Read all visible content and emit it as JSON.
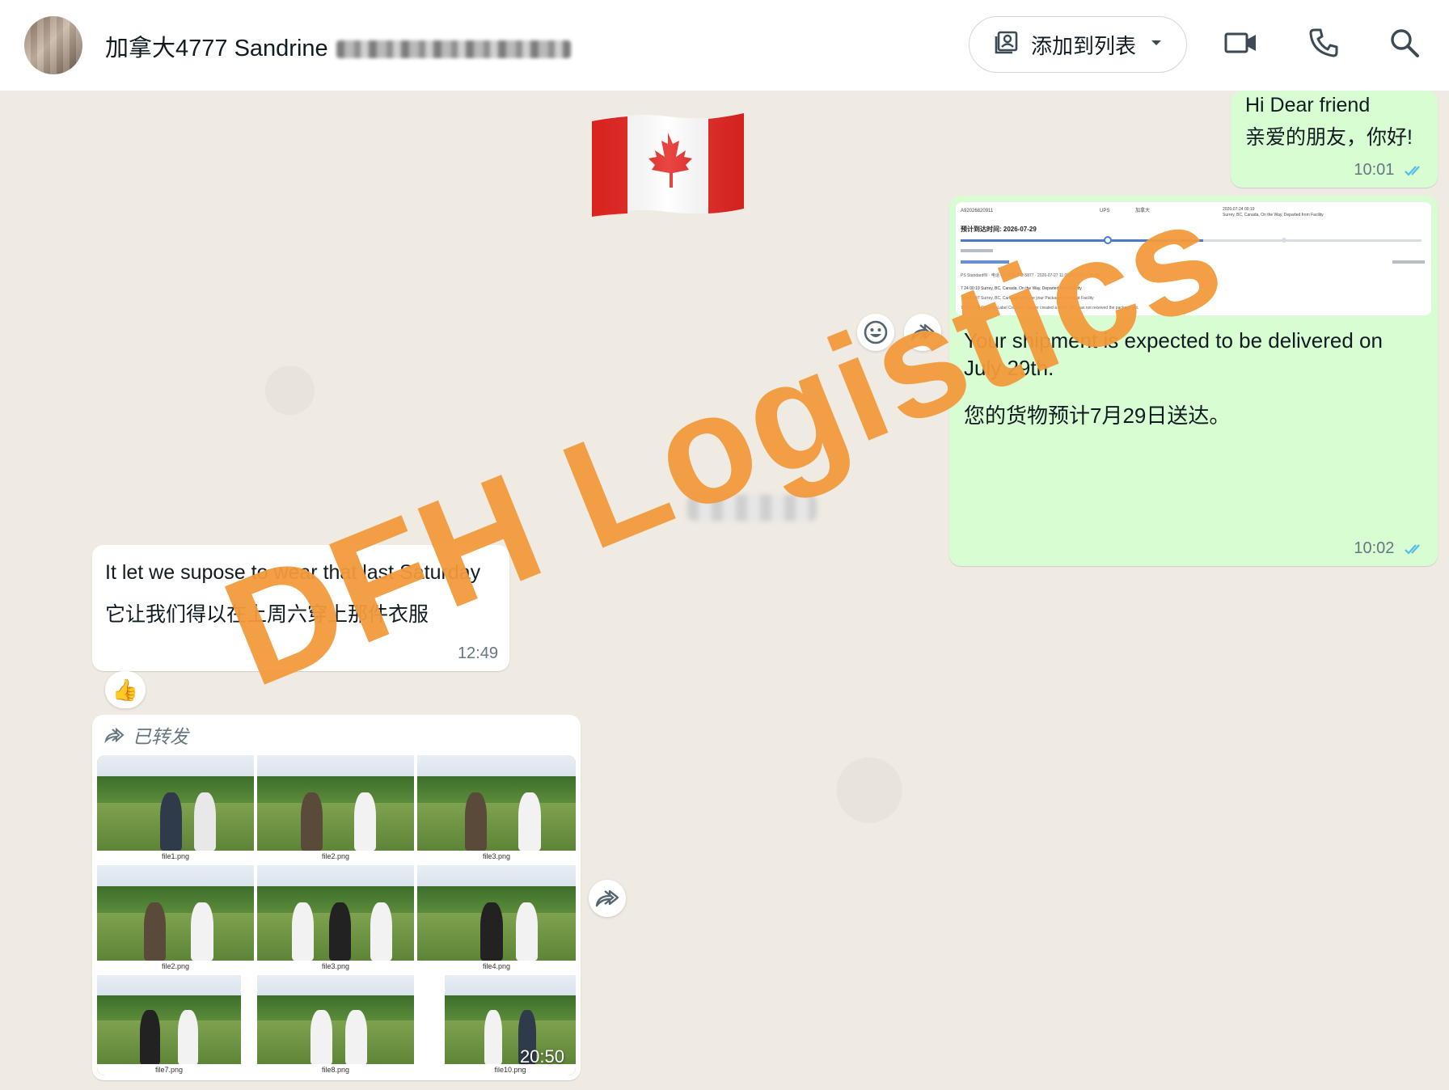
{
  "header": {
    "contact_name": "加拿大4777 Sandrine",
    "add_to_list_label": "添加到列表"
  },
  "messages": {
    "m1": {
      "line1": "Hi Dear friend",
      "line2": "亲爱的朋友，你好!",
      "time": "10:01"
    },
    "m2": {
      "text_en": "Your shipment is expected to be delivered on July 29th.",
      "text_zh": "您的货物预计7月29日送达。",
      "time": "10:02",
      "screenshot": {
        "tracking_no": "A92026820911",
        "carrier": "UPS",
        "destination": "加拿大",
        "date_line": "2026-07-24 00:19",
        "status_line": "Surrey, BC, Canada, On the Way, Departed from Facility",
        "eta_label": "预计到达时间: 2026-07-29",
        "events": [
          "7 24 00:19  Surrey, BC, Canada, On the Way, Departed from Facility",
          "7 23 19:37  Surrey, BC, Canada, We have your Package, Arrived at Facility",
          "7 23 09:58  Canada, Label Created, Shipper created a label, UPS has not received the package yet."
        ]
      }
    },
    "m3": {
      "line1": "It let we supose  to wear that last Saturday",
      "line2": "它让我们得以在上周六穿上那件衣服",
      "time": "12:49"
    },
    "m3_reaction": "👍",
    "m4": {
      "forwarded_label": "已转发",
      "files": [
        "file1.png",
        "file2.png",
        "file3.png",
        "file2.png",
        "file3.png",
        "file4.png",
        "file7.png",
        "file8.png",
        "file10.png"
      ],
      "duration": "20:50"
    }
  },
  "watermark": "DFH Logistics",
  "colors": {
    "outgoing_bubble": "#d9fdd3",
    "incoming_bubble": "#ffffff",
    "chat_background": "#efeae2",
    "read_ticks": "#53bdeb",
    "watermark": "#f29a3c"
  },
  "icons": {
    "add_list": "contact-list-icon",
    "video": "video-call-icon",
    "phone": "voice-call-icon",
    "search": "search-icon",
    "emoji": "emoji-icon",
    "forward": "forward-icon"
  }
}
